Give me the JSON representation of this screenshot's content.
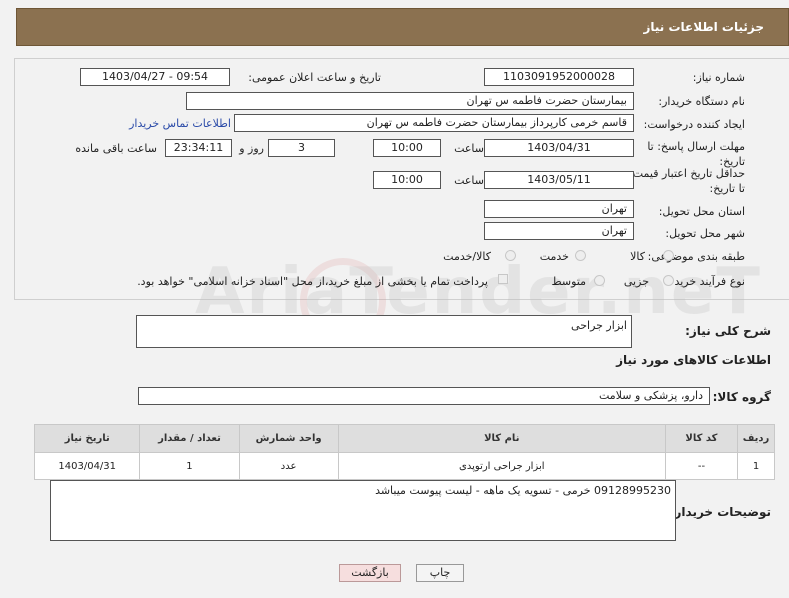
{
  "header": {
    "title": "جزئیات اطلاعات نیاز"
  },
  "form": {
    "need_number_label": "شماره نیاز:",
    "need_number": "1103091952000028",
    "announce_label": "تاریخ و ساعت اعلان عمومی:",
    "announce_value": "1403/04/27 - 09:54",
    "buyer_org_label": "نام دستگاه خریدار:",
    "buyer_org": "بیمارستان حضرت فاطمه س  تهران",
    "creator_label": "ایجاد کننده درخواست:",
    "creator": "قاسم خرمی کارپرداز بیمارستان حضرت فاطمه س  تهران",
    "contact_link": "اطلاعات تماس خریدار",
    "reply_deadline_label": "مهلت ارسال پاسخ: تا تاریخ:",
    "reply_date": "1403/04/31",
    "time_label": "ساعت",
    "reply_time": "10:00",
    "days": "3",
    "days_label": "روز و",
    "remaining_time": "23:34:11",
    "remaining_label": "ساعت باقی مانده",
    "price_deadline_label": "حداقل تاریخ اعتبار قیمت: تا تاریخ:",
    "price_date": "1403/05/11",
    "price_time": "10:00",
    "province_label": "استان محل تحویل:",
    "province": "تهران",
    "city_label": "شهر محل تحویل:",
    "city": "تهران",
    "category_label": "طبقه بندی موضوعی:",
    "category_options": [
      "کالا",
      "خدمت",
      "کالا/خدمت"
    ],
    "process_label": "نوع فرآیند خرید :",
    "process_options": [
      "جزیی",
      "متوسط"
    ],
    "payment_note": "پرداخت تمام یا بخشی از مبلغ خرید،از محل \"اسناد خزانه اسلامی\" خواهد بود."
  },
  "summary": {
    "label": "شرح کلی نیاز:",
    "value": "ابزار جراحی"
  },
  "goods_info_title": "اطلاعات کالاهای مورد نیاز",
  "goods_group": {
    "label": "گروه کالا:",
    "value": "دارو، پزشکی و سلامت"
  },
  "table": {
    "headers": [
      "ردیف",
      "کد کالا",
      "نام کالا",
      "واحد شمارش",
      "تعداد / مقدار",
      "تاریخ نیاز"
    ],
    "rows": [
      [
        "1",
        "--",
        "ابزار جراحی ارتوپدی",
        "عدد",
        "1",
        "1403/04/31"
      ]
    ]
  },
  "buyer_notes": {
    "label": "توضیحات خریدار:",
    "value": "09128995230 خرمی - تسویه یک ماهه - لیست پیوست میباشد"
  },
  "buttons": {
    "print": "چاپ",
    "back": "بازگشت"
  },
  "watermark": "AriaTender.neT"
}
